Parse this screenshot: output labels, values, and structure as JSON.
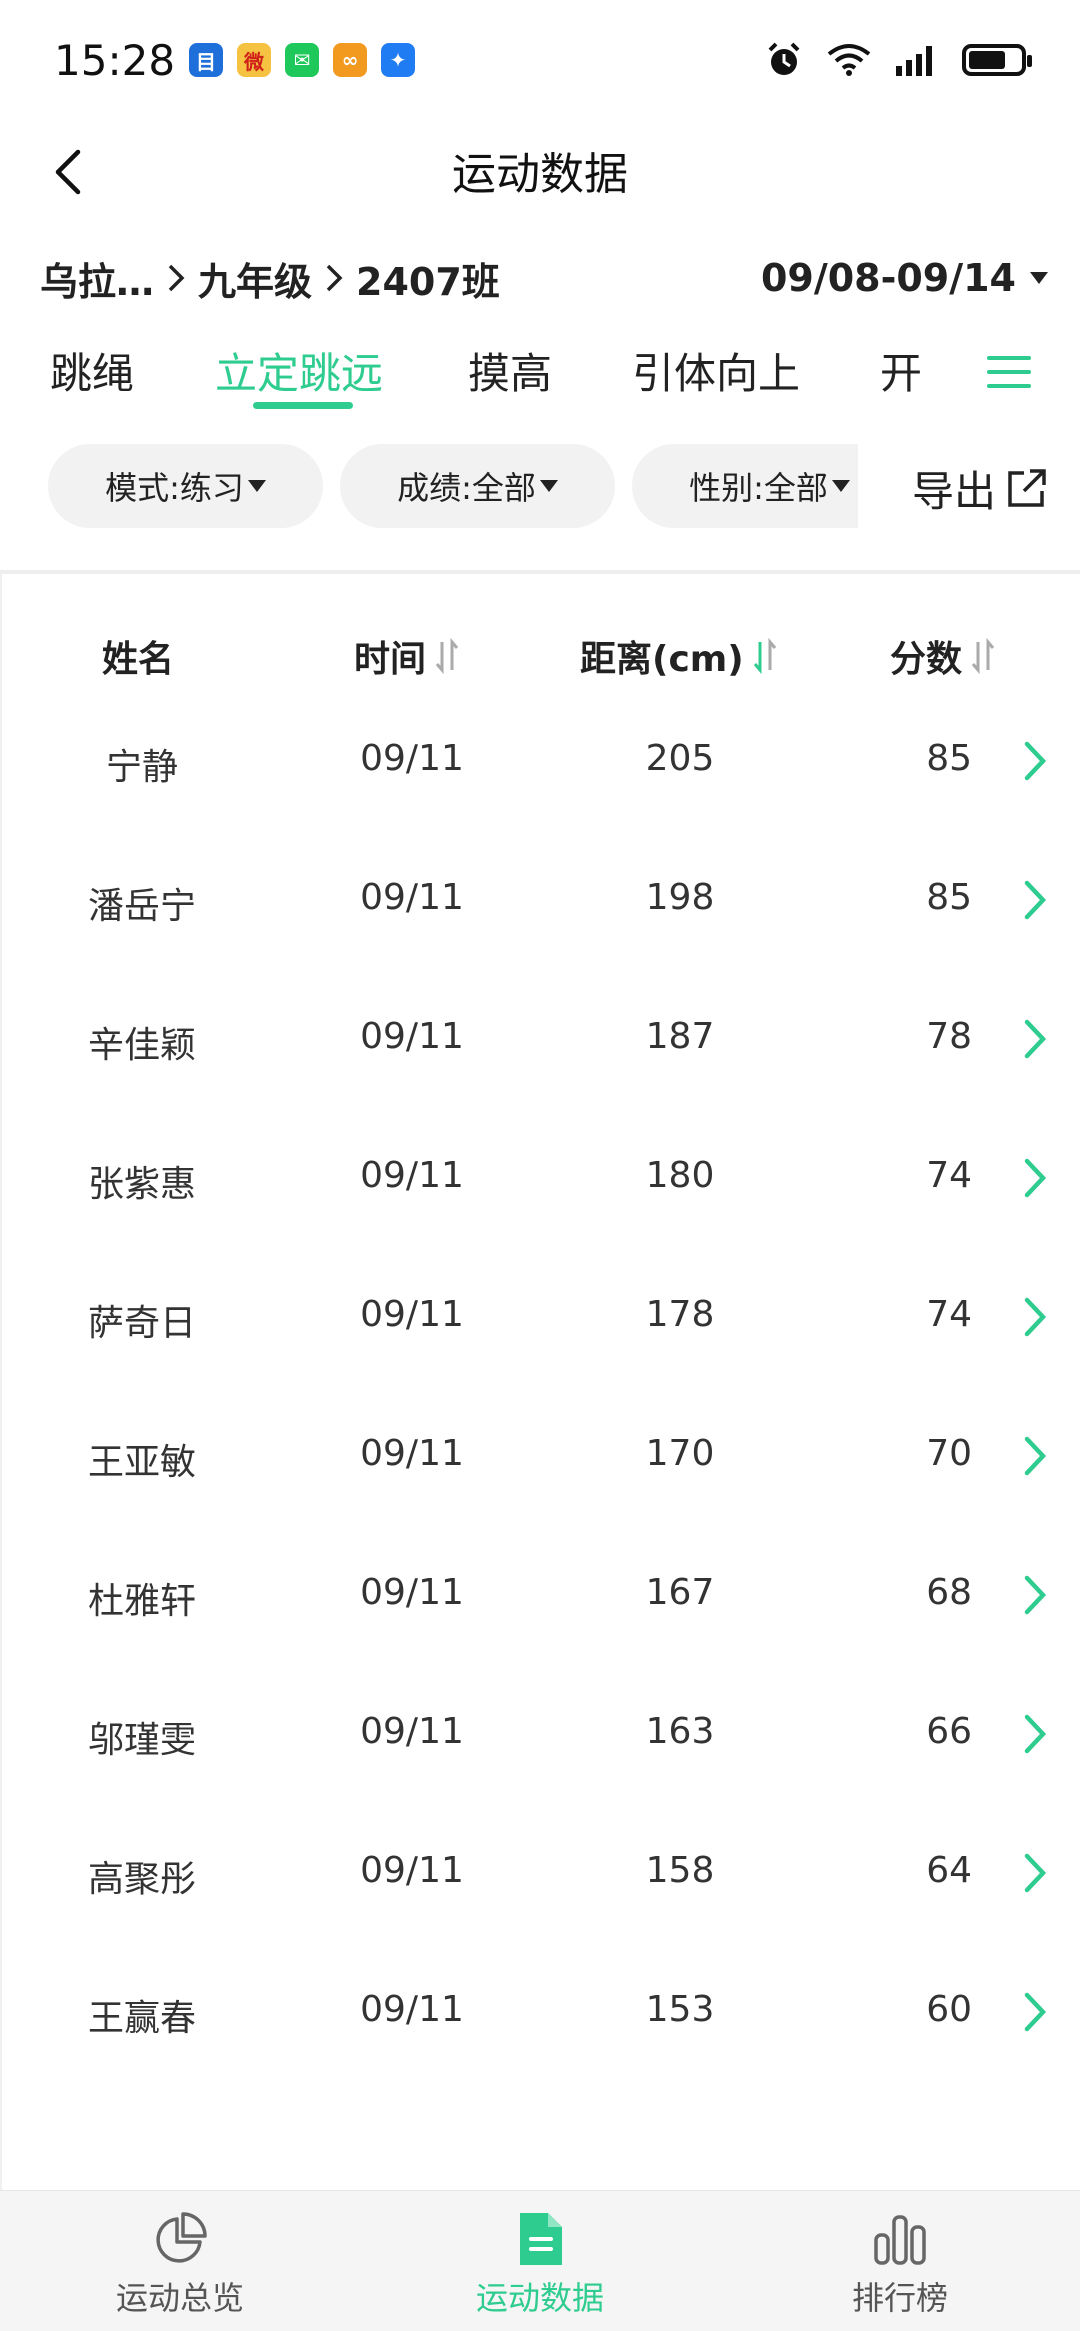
{
  "status_bar": {
    "time": "15:28",
    "apps": [
      {
        "icon": "app-blue-icon",
        "color": "#1e6fd9",
        "glyph": "目"
      },
      {
        "icon": "weibo-icon",
        "color": "#f5c242",
        "glyph": "微"
      },
      {
        "icon": "wechat-icon",
        "color": "#1ec85a",
        "glyph": "✉"
      },
      {
        "icon": "app-orange-icon",
        "color": "#f29a20",
        "glyph": "∞"
      },
      {
        "icon": "app-feather-icon",
        "color": "#1f7cf2",
        "glyph": "✦"
      }
    ]
  },
  "header": {
    "title": "运动数据"
  },
  "breadcrumb": {
    "school": "乌拉…",
    "grade": "九年级",
    "class": "2407班",
    "date_range": "09/08-09/14"
  },
  "tabs": [
    {
      "label": "跳绳",
      "active": false
    },
    {
      "label": "立定跳远",
      "active": true
    },
    {
      "label": "摸高",
      "active": false
    },
    {
      "label": "引体向上",
      "active": false
    },
    {
      "label": "开合",
      "active": false
    }
  ],
  "filters": {
    "mode": "模式:练习",
    "score": "成绩:全部",
    "gender": "性别:全部",
    "export_label": "导出"
  },
  "table": {
    "columns": {
      "name": "姓名",
      "time": "时间",
      "distance": "距离(cm)",
      "score": "分数"
    },
    "rows": [
      {
        "name": "宁静",
        "time": "09/11",
        "distance": "205",
        "score": "85"
      },
      {
        "name": "潘岳宁",
        "time": "09/11",
        "distance": "198",
        "score": "85"
      },
      {
        "name": "辛佳颖",
        "time": "09/11",
        "distance": "187",
        "score": "78"
      },
      {
        "name": "张紫惠",
        "time": "09/11",
        "distance": "180",
        "score": "74"
      },
      {
        "name": "萨奇日",
        "time": "09/11",
        "distance": "178",
        "score": "74"
      },
      {
        "name": "王亚敏",
        "time": "09/11",
        "distance": "170",
        "score": "70"
      },
      {
        "name": "杜雅轩",
        "time": "09/11",
        "distance": "167",
        "score": "68"
      },
      {
        "name": "邬瑾雯",
        "time": "09/11",
        "distance": "163",
        "score": "66"
      },
      {
        "name": "高聚彤",
        "time": "09/11",
        "distance": "158",
        "score": "64"
      },
      {
        "name": "王赢春",
        "time": "09/11",
        "distance": "153",
        "score": "60"
      }
    ]
  },
  "bottom_nav": [
    {
      "label": "运动总览",
      "icon": "pie-chart-icon",
      "active": false
    },
    {
      "label": "运动数据",
      "icon": "document-icon",
      "active": true
    },
    {
      "label": "排行榜",
      "icon": "bar-chart-icon",
      "active": false
    }
  ],
  "colors": {
    "accent": "#2ecc8f",
    "text": "#222222",
    "chip_bg": "#f2f2f2",
    "nav_bg": "#f5f5f5"
  }
}
